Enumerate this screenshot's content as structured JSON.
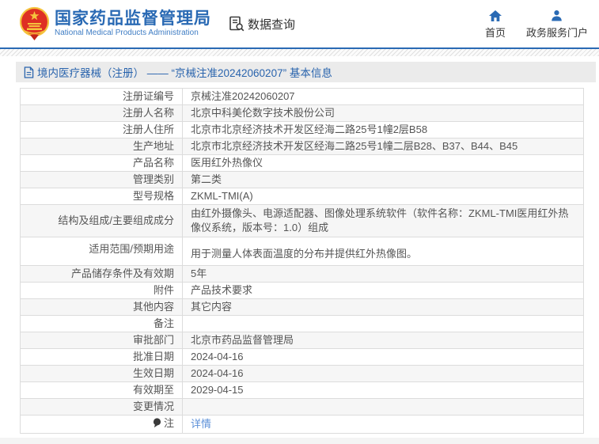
{
  "header": {
    "org_name_zh": "国家药品监督管理局",
    "org_name_en": "National Medical Products Administration",
    "data_query_label": "数据查询",
    "nav": [
      {
        "id": "home",
        "label": "首页",
        "icon": "home-icon"
      },
      {
        "id": "gov-portal",
        "label": "政务服务门户",
        "icon": "user-icon"
      }
    ]
  },
  "breadcrumb": {
    "text": "境内医疗器械（注册） —— “京械注准20242060207” 基本信息"
  },
  "table": {
    "rows": [
      {
        "id": "reg-cert-no",
        "label": "注册证编号",
        "value": "京械注准20242060207"
      },
      {
        "id": "registrant-name",
        "label": "注册人名称",
        "value": "北京中科美伦数字技术股份公司"
      },
      {
        "id": "registrant-address",
        "label": "注册人住所",
        "value": "北京市北京经济技术开发区经海二路25号1幢2层B58"
      },
      {
        "id": "production-address",
        "label": "生产地址",
        "value": "北京市北京经济技术开发区经海二路25号1幢二层B28、B37、B44、B45"
      },
      {
        "id": "product-name",
        "label": "产品名称",
        "value": "医用红外热像仪"
      },
      {
        "id": "management-class",
        "label": "管理类别",
        "value": "第二类"
      },
      {
        "id": "model-spec",
        "label": "型号规格",
        "value": "ZKML-TMI(A)"
      },
      {
        "id": "structure",
        "label": "结构及组成/主要组成成分",
        "value": "由红外摄像头、电源适配器、图像处理系统软件（软件名称：ZKML-TMI医用红外热像仪系统，版本号：1.0）组成"
      },
      {
        "id": "intended-use",
        "label": "适用范围/预期用途",
        "value": "用于测量人体表面温度的分布并提供红外热像图。"
      },
      {
        "id": "storage-validity",
        "label": "产品储存条件及有效期",
        "value": "5年"
      },
      {
        "id": "attachment",
        "label": "附件",
        "value": "产品技术要求"
      },
      {
        "id": "other-content",
        "label": "其他内容",
        "value": "其它内容"
      },
      {
        "id": "remarks",
        "label": "备注",
        "value": ""
      },
      {
        "id": "approval-dept",
        "label": "审批部门",
        "value": "北京市药品监督管理局"
      },
      {
        "id": "approval-date",
        "label": "批准日期",
        "value": "2024-04-16"
      },
      {
        "id": "effective-date",
        "label": "生效日期",
        "value": "2024-04-16"
      },
      {
        "id": "expiry-date",
        "label": "有效期至",
        "value": "2029-04-15"
      },
      {
        "id": "change-status",
        "label": "变更情况",
        "value": ""
      },
      {
        "id": "note",
        "label": "注",
        "value": "详情",
        "label_icon": "note-balloon-icon",
        "link": true
      }
    ]
  },
  "colors": {
    "brand_blue": "#2a6ab4",
    "brand_blue_light": "#3f7dc4",
    "breadcrumb_blue": "#2a64ad",
    "link_blue": "#5b8fd8",
    "emblem_red": "#de2f23",
    "emblem_gold": "#f5c33d"
  }
}
